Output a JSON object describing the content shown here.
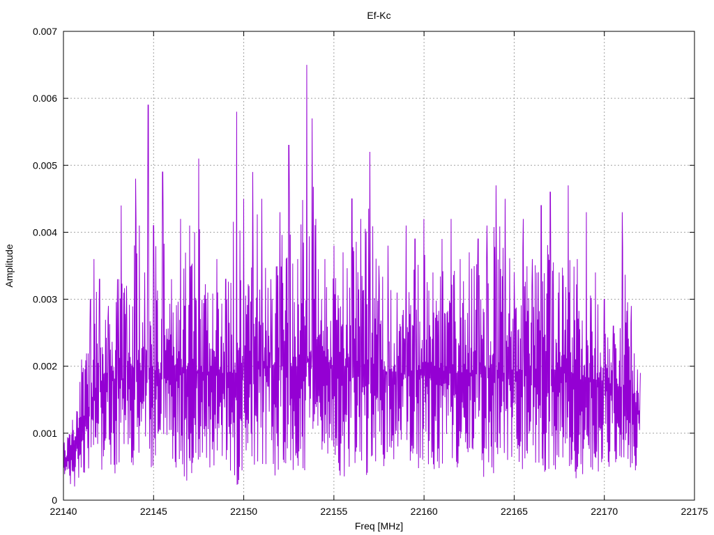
{
  "chart_data": {
    "type": "line",
    "title": "Ef-Kc",
    "xlabel": "Freq [MHz]",
    "ylabel": "Amplitude",
    "xlim": [
      22140,
      22175
    ],
    "ylim": [
      0,
      0.007
    ],
    "x_ticks": [
      22140,
      22145,
      22150,
      22155,
      22160,
      22165,
      22170,
      22175
    ],
    "x_tick_labels": [
      "22140",
      "22145",
      "22150",
      "22155",
      "22160",
      "22165",
      "22170",
      "22175"
    ],
    "y_ticks": [
      0,
      0.001,
      0.002,
      0.003,
      0.004,
      0.005,
      0.006,
      0.007
    ],
    "y_tick_labels": [
      "0",
      "0.001",
      "0.002",
      "0.003",
      "0.004",
      "0.005",
      "0.006",
      "0.007"
    ],
    "grid": true,
    "legend": "none",
    "series": [
      {
        "color": "#9400d3",
        "x_range": [
          22140,
          22172
        ],
        "x": [
          22140.0,
          22140.5,
          22141.0,
          22141.5,
          22141.7,
          22142.0,
          22142.5,
          22143.0,
          22143.2,
          22143.5,
          22144.0,
          22144.2,
          22144.5,
          22144.7,
          22145.0,
          22145.5,
          22146.0,
          22146.5,
          22147.0,
          22147.5,
          22148.0,
          22148.5,
          22149.0,
          22149.6,
          22150.0,
          22150.5,
          22151.0,
          22151.5,
          22152.0,
          22152.5,
          22153.0,
          22153.5,
          22153.8,
          22154.0,
          22154.5,
          22155.0,
          22155.5,
          22156.0,
          22156.5,
          22157.0,
          22157.5,
          22158.0,
          22158.5,
          22159.0,
          22159.5,
          22160.0,
          22160.5,
          22161.0,
          22161.5,
          22162.0,
          22162.5,
          22163.0,
          22163.5,
          22164.0,
          22164.5,
          22165.0,
          22165.5,
          22166.0,
          22166.5,
          22167.0,
          22167.5,
          22168.0,
          22168.5,
          22169.0,
          22169.5,
          22170.0,
          22170.5,
          22171.0,
          22171.5,
          22172.0
        ],
        "y_peaks": [
          0.0009,
          0.0012,
          0.0021,
          0.003,
          0.0036,
          0.0033,
          0.0029,
          0.0033,
          0.0044,
          0.0032,
          0.0048,
          0.0041,
          0.0034,
          0.0059,
          0.0041,
          0.0049,
          0.0033,
          0.0042,
          0.0041,
          0.0051,
          0.0031,
          0.0036,
          0.0033,
          0.0058,
          0.0045,
          0.0049,
          0.0045,
          0.0033,
          0.0043,
          0.0053,
          0.0036,
          0.0065,
          0.0057,
          0.0042,
          0.0036,
          0.0038,
          0.0037,
          0.0045,
          0.0042,
          0.0052,
          0.0035,
          0.0038,
          0.0031,
          0.0041,
          0.0039,
          0.0042,
          0.0034,
          0.0039,
          0.0042,
          0.0036,
          0.0037,
          0.0039,
          0.0041,
          0.0047,
          0.0045,
          0.0034,
          0.0042,
          0.0036,
          0.0044,
          0.0046,
          0.0034,
          0.0047,
          0.0036,
          0.0043,
          0.0034,
          0.003,
          0.0026,
          0.0043,
          0.0029,
          0.0019
        ],
        "y_troughs": [
          0.0003,
          0.0001,
          0.0004,
          0.0003,
          0.0006,
          0.0004,
          0.0005,
          0.0003,
          0.0002,
          0.0004,
          0.0005,
          0.0003,
          0.0006,
          0.0004,
          0.0004,
          0.0005,
          0.0005,
          0.0004,
          0.0002,
          0.0005,
          0.0005,
          0.0004,
          0.0006,
          0.0001,
          0.0005,
          0.0003,
          0.0005,
          0.0003,
          0.0004,
          0.0005,
          0.0003,
          0.0004,
          0.0005,
          0.0005,
          0.0006,
          0.0003,
          0.0003,
          0.0005,
          0.0003,
          0.0004,
          0.0005,
          0.0005,
          0.0006,
          0.0006,
          0.0004,
          0.0005,
          0.0003,
          0.0005,
          0.0004,
          0.0005,
          0.0005,
          0.0004,
          0.0003,
          0.0004,
          0.0005,
          0.0005,
          0.0004,
          0.0005,
          0.0004,
          0.0004,
          0.0004,
          0.0004,
          0.0001,
          0.0005,
          0.0004,
          0.0004,
          0.0004,
          0.0005,
          0.0001,
          0.0007
        ],
        "y_baseline": [
          0.0005,
          0.0008,
          0.0012,
          0.0014,
          0.0016,
          0.0017,
          0.0018,
          0.0018,
          0.0018,
          0.0018,
          0.0019,
          0.0019,
          0.0019,
          0.0019,
          0.0019,
          0.0019,
          0.0019,
          0.0019,
          0.0019,
          0.0019,
          0.0019,
          0.0019,
          0.0019,
          0.0019,
          0.002,
          0.002,
          0.002,
          0.002,
          0.002,
          0.002,
          0.002,
          0.0021,
          0.0021,
          0.0021,
          0.0021,
          0.002,
          0.002,
          0.002,
          0.002,
          0.002,
          0.002,
          0.0019,
          0.0019,
          0.0019,
          0.0019,
          0.0019,
          0.0019,
          0.0019,
          0.0019,
          0.0019,
          0.0019,
          0.0019,
          0.0019,
          0.0019,
          0.0019,
          0.0019,
          0.0019,
          0.0019,
          0.0019,
          0.0019,
          0.0019,
          0.0019,
          0.0018,
          0.0018,
          0.0018,
          0.0017,
          0.0016,
          0.0016,
          0.0015,
          0.0013
        ],
        "sample_count": 1400
      }
    ]
  }
}
